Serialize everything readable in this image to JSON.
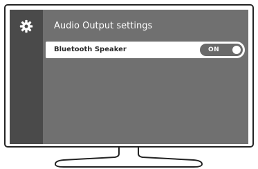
{
  "screen": {
    "title": "Audio Output settings",
    "sidebar_icon": "gear-icon",
    "settings": [
      {
        "label": "Bluetooth Speaker",
        "toggle_label": "ON",
        "toggle_state": true
      }
    ]
  },
  "colors": {
    "screen_bg": "#707070",
    "sidebar_bg": "#4a4a4a",
    "bezel": "#232323",
    "row_bg": "#ffffff",
    "toggle_bg": "#6a6a6a"
  }
}
